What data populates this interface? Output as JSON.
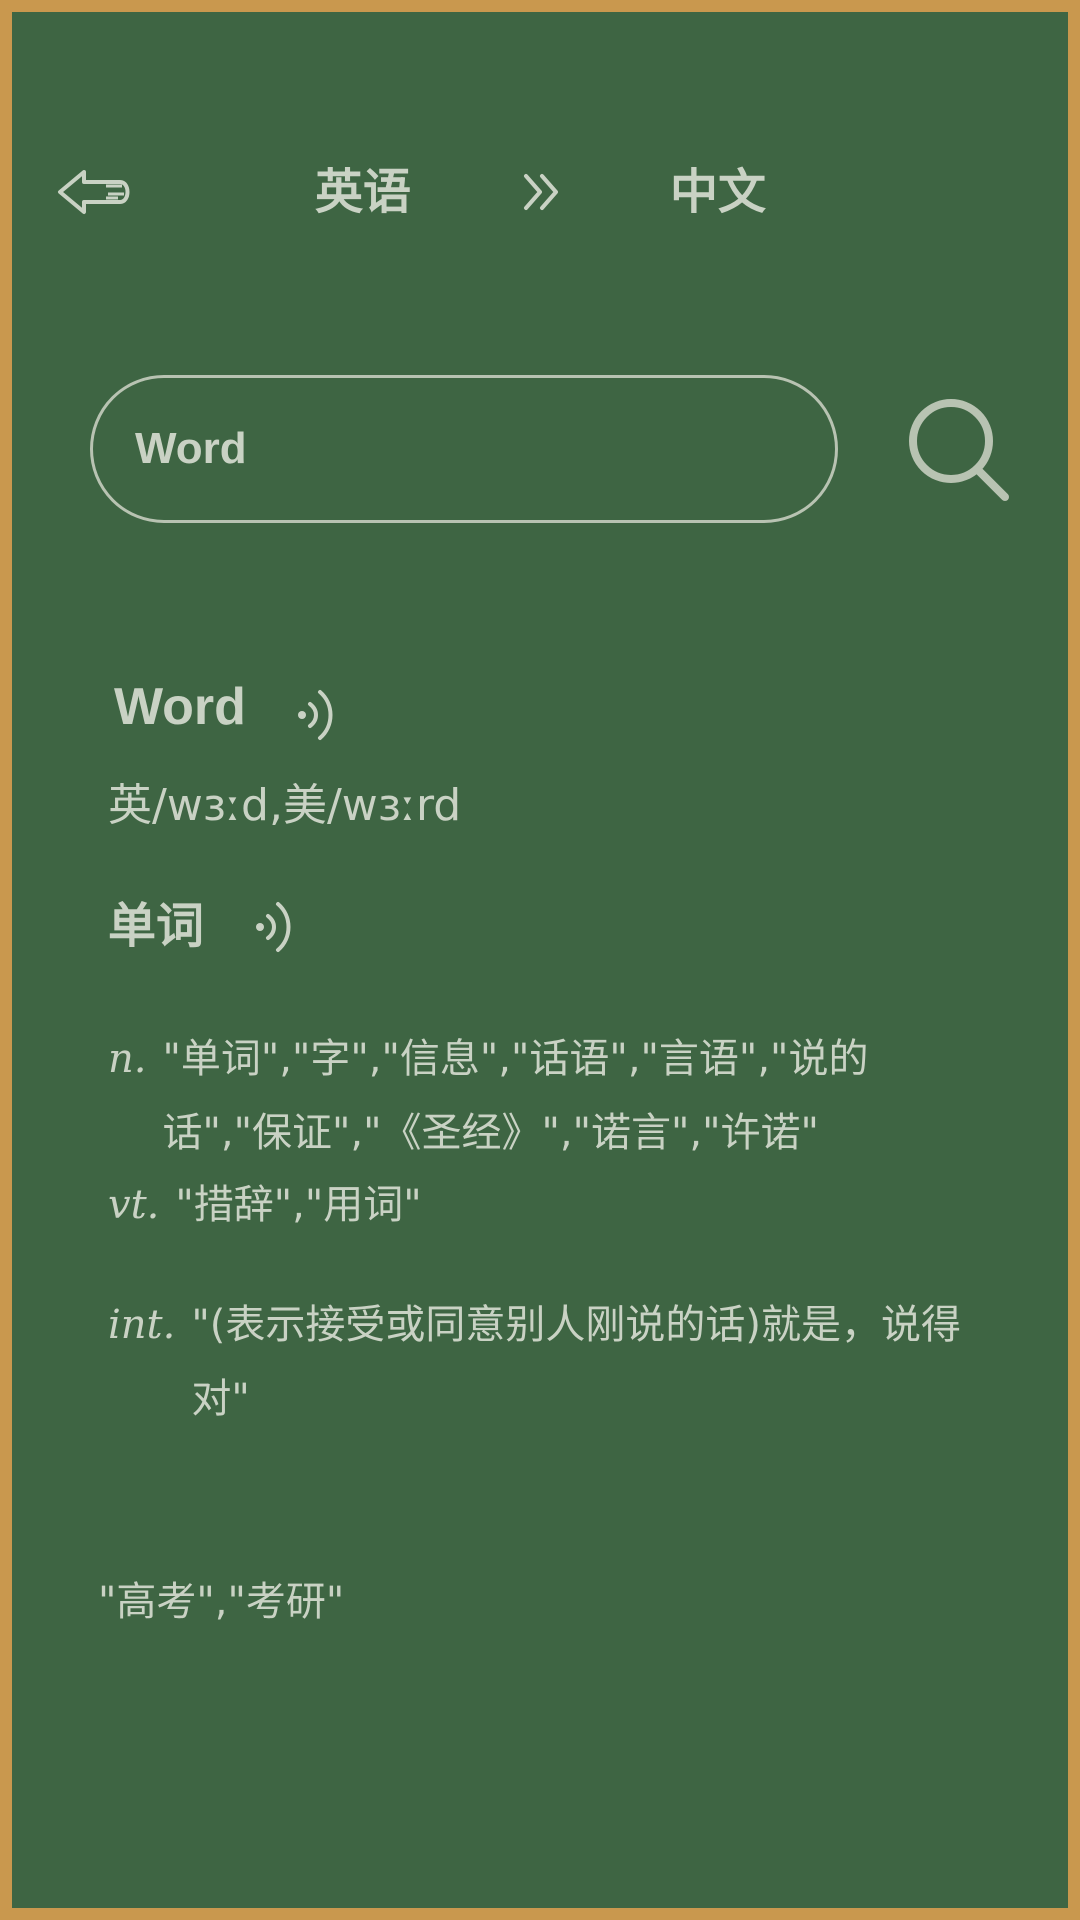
{
  "header": {
    "back_icon": "back-arrow-icon",
    "source_language": "英语",
    "swap_icon": "double-chevron-right-icon",
    "target_language": "中文"
  },
  "search": {
    "value": "Word",
    "icon": "search-icon"
  },
  "result": {
    "word": "Word",
    "phonetic": "英/wɜːd,美/wɜːrd",
    "meaning": "单词",
    "speaker_icon": "speaker-icon",
    "definitions": [
      {
        "pos": "n.",
        "text": "\"单词\",\"字\",\"信息\",\"话语\",\"言语\",\"说的话\",\"保证\",\"《圣经》\",\"诺言\",\"许诺\""
      },
      {
        "pos": "vt.",
        "text": "\"措辞\",\"用词\""
      },
      {
        "pos": "int.",
        "text": "\"(表示接受或同意别人刚说的话)就是，说得对\""
      }
    ],
    "tags": "\"高考\",\"考研\""
  },
  "colors": {
    "board": "#3e6543",
    "frame": "#c9984e",
    "chalk": "#c9d2c4"
  }
}
